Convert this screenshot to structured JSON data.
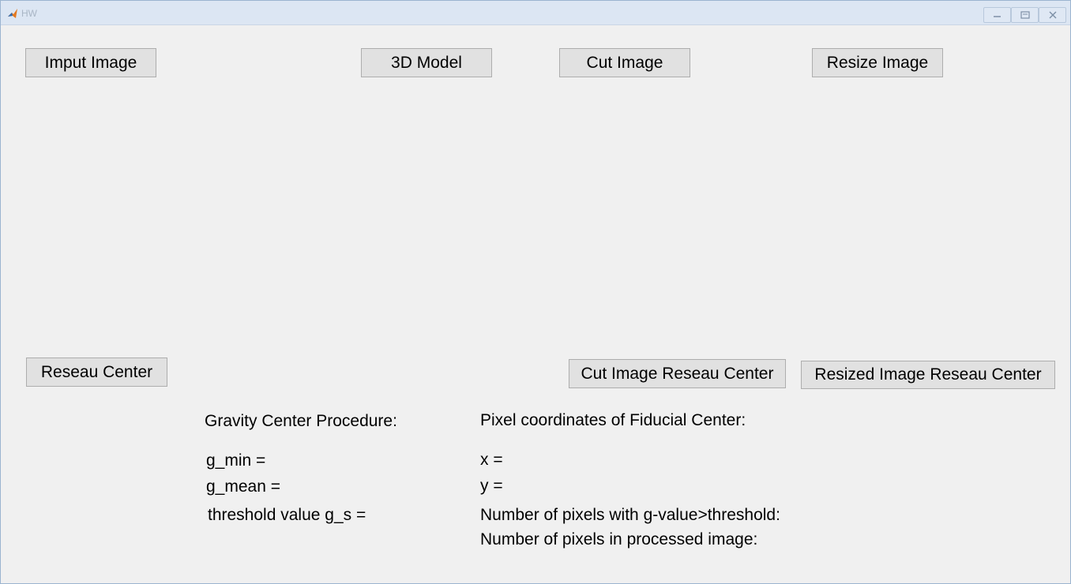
{
  "window": {
    "title": "HW",
    "minimize_icon": "minimize-icon",
    "restore_icon": "restore-icon",
    "close_icon": "close-icon"
  },
  "buttons": {
    "input_image": "Imput Image",
    "model_3d": "3D Model",
    "cut_image": "Cut Image",
    "resize_image": "Resize Image",
    "reseau_center": "Reseau Center",
    "cut_image_reseau_center": "Cut Image Reseau Center",
    "resized_image_reseau_center": "Resized Image Reseau Center"
  },
  "gravity": {
    "heading": "Gravity Center Procedure:",
    "g_min": "g_min =",
    "g_mean": "g_mean =",
    "threshold": "threshold value g_s ="
  },
  "fiducial": {
    "heading": "Pixel coordinates of Fiducial Center:",
    "x": "x =",
    "y": "y =",
    "pixels_above": "Number of pixels with g-value>threshold:",
    "pixels_total": "Number of pixels in processed image:"
  }
}
